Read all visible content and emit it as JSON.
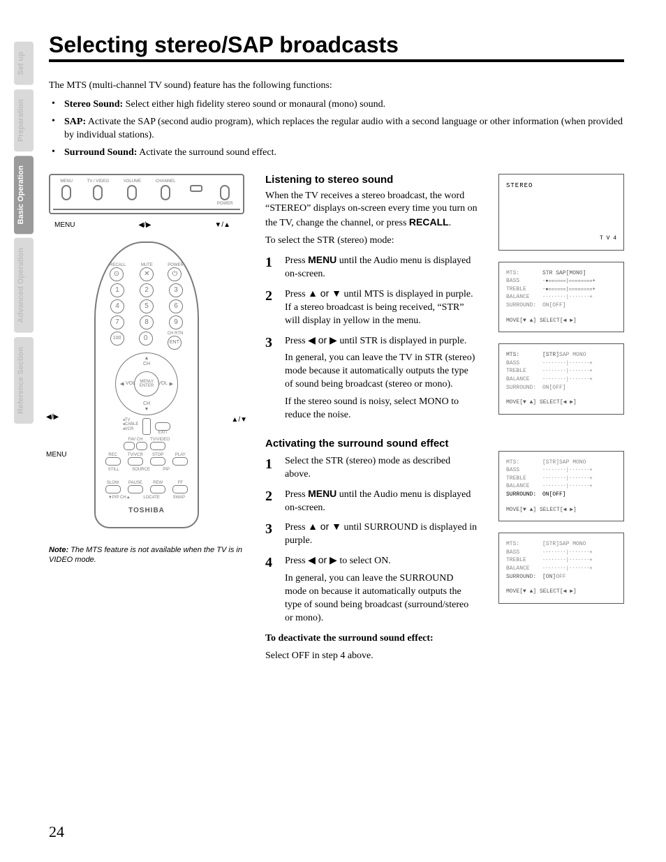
{
  "side_tabs": [
    "Set up",
    "Preparation",
    "Basic Operation",
    "Advanced Operation",
    "Reference Section"
  ],
  "title": "Selecting stereo/SAP broadcasts",
  "intro": "The MTS (multi-channel TV sound) feature has the following functions:",
  "bullets": [
    {
      "label": "Stereo Sound:",
      "text": " Select either high fidelity stereo sound or monaural (mono) sound."
    },
    {
      "label": "SAP:",
      "text": " Activate the SAP (second audio program), which replaces the regular audio with a second language or other information (when provided by individual stations)."
    },
    {
      "label": "Surround Sound:",
      "text": " Activate the surround sound effect."
    }
  ],
  "tv_panel_labels": [
    "MENU",
    "TV / VIDEO",
    "VOLUME",
    "CHANNEL",
    "POWER"
  ],
  "tv_callouts": {
    "menu": "MENU",
    "lr": "◀/▶",
    "ud": "▼/▲"
  },
  "remote_labels": {
    "recall": "RECALL",
    "mute": "MUTE",
    "power": "POWER",
    "chrtn": "CH RTN",
    "ent": "ENT",
    "hundred": "100",
    "ch": "CH",
    "vol": "VOL",
    "menu_enter": "MENU/\nENTER",
    "tv": "TV",
    "cable": "CABLE",
    "vcr": "VCR",
    "exit": "EXIT",
    "favch": "FAV CH",
    "tvvideo": "TV/VIDEO",
    "rec": "REC",
    "tvvcr": "TV/VCR",
    "stop": "STOP",
    "play": "PLAY",
    "slow": "SLOW",
    "pause": "PAUSE",
    "rew": "REW",
    "ff": "FF",
    "still": "STILL",
    "source": "SOURCE",
    "pip": "PIP",
    "pipch": "▼PIP CH▲",
    "locate": "LOCATE",
    "swap": "SWAP",
    "brand": "TOSHIBA"
  },
  "remote_callouts": {
    "lr": "◀/▶",
    "menu": "MENU",
    "ud": "▲/▼"
  },
  "note": {
    "prefix": "Note:",
    "text": " The MTS feature is not available when the TV is in VIDEO mode."
  },
  "section1": {
    "heading": "Listening to stereo sound",
    "para": "When the TV receives a stereo broadcast, the word “STEREO” displays on-screen every time you turn on the TV, change the channel, or press ",
    "para_bold": "RECALL",
    "para_end": ".",
    "lead": "To select the STR (stereo) mode:",
    "steps": [
      {
        "pre": "Press ",
        "bold": "MENU",
        "post": " until the Audio menu is displayed on-screen."
      },
      {
        "pre": "Press ",
        "sym": "▲ or ▼",
        "post": " until MTS is displayed in purple. If a stereo broadcast is being received, “STR” will display in yellow in the menu."
      },
      {
        "pre": "Press ",
        "sym": "◀ or ▶",
        "post": " until STR is displayed in purple.",
        "sub1": "In general, you can leave the TV in STR (stereo) mode because it automatically outputs the type of sound being broadcast (stereo or mono).",
        "sub2": "If the stereo sound is noisy, select MONO to reduce the noise."
      }
    ]
  },
  "section2": {
    "heading": "Activating the surround sound effect",
    "steps": [
      {
        "pre": "Select the STR (stereo) mode as described above."
      },
      {
        "pre": "Press ",
        "bold": "MENU",
        "post": " until the Audio menu is displayed on-screen."
      },
      {
        "pre": "Press ",
        "sym": "▲ or ▼",
        "post": " until SURROUND is displayed in purple."
      },
      {
        "pre": "Press ",
        "sym": "◀ or ▶",
        "post": " to select ON.",
        "sub1": "In general, you can leave the SURROUND mode on because it automatically outputs the type of sound being broadcast (surround/stereo or mono)."
      }
    ],
    "deact_head": "To deactivate the surround sound effect:",
    "deact_body": "Select OFF in step 4 above."
  },
  "osd": {
    "stereo": "STEREO",
    "tv4": "T V      4",
    "keys": [
      "MTS:",
      "BASS",
      "TREBLE",
      "BALANCE",
      "SURROUND:"
    ],
    "mts_vals": " STR SAP[MONO]",
    "mts_vals2": "[STR]SAP MONO",
    "onoff": " ON[OFF]",
    "onoff2": "[ON]OFF",
    "footer": "MOVE[▼ ▲]  SELECT[◀ ▶]",
    "slider_dark": "-▪▫▫▫▫▫▫|▫▫▫▫▫▫▫▫+",
    "slider": "-·······|·······+"
  },
  "page": "24"
}
